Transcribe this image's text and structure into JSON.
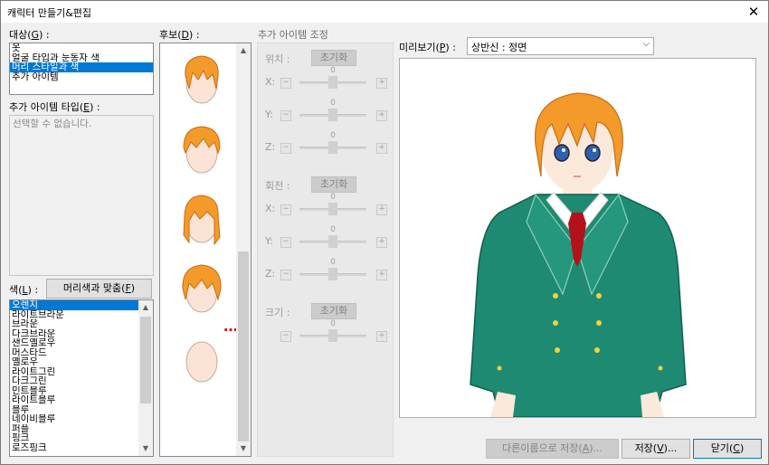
{
  "window": {
    "title": "캐릭터 만들기&편집",
    "close_glyph": "✕"
  },
  "target": {
    "label_prefix": "대상(",
    "label_key": "G",
    "label_suffix": ") :",
    "items": [
      {
        "label": "옷",
        "selected": false
      },
      {
        "label": "얼굴 타입과 눈동자 색",
        "selected": false
      },
      {
        "label": "머리 스타일과 색",
        "selected": true
      },
      {
        "label": "추가 아이템",
        "selected": false
      }
    ]
  },
  "extra_type": {
    "label_prefix": "추가 아이템 타입(",
    "label_key": "E",
    "label_suffix": ") :",
    "placeholder": "선택할 수 없습니다."
  },
  "color": {
    "label_prefix": "색(",
    "label_key": "L",
    "label_suffix": ") :",
    "match_button": {
      "prefix": "머리색과 맞춤(",
      "key": "F",
      "suffix": ")"
    },
    "items": [
      {
        "label": "오렌지",
        "selected": true
      },
      {
        "label": "라이트브라운",
        "selected": false
      },
      {
        "label": "브라운",
        "selected": false
      },
      {
        "label": "다크브라운",
        "selected": false
      },
      {
        "label": "샌드옐로우",
        "selected": false
      },
      {
        "label": "머스타드",
        "selected": false
      },
      {
        "label": "옐로우",
        "selected": false
      },
      {
        "label": "라이트그린",
        "selected": false
      },
      {
        "label": "다크그린",
        "selected": false
      },
      {
        "label": "민트블루",
        "selected": false
      },
      {
        "label": "라이트블루",
        "selected": false
      },
      {
        "label": "블루",
        "selected": false
      },
      {
        "label": "네이비블루",
        "selected": false
      },
      {
        "label": "퍼플",
        "selected": false
      },
      {
        "label": "핑크",
        "selected": false
      },
      {
        "label": "로즈핑크",
        "selected": false
      }
    ]
  },
  "candidates": {
    "label_prefix": "후보(",
    "label_key": "D",
    "label_suffix": ") :",
    "items": [
      {
        "name": "hair-style-1",
        "type": "hair"
      },
      {
        "name": "hair-style-2",
        "type": "hair"
      },
      {
        "name": "hair-style-3",
        "type": "hair"
      },
      {
        "name": "hair-style-4",
        "type": "hair"
      },
      {
        "name": "bald-head",
        "type": "bald"
      }
    ],
    "more_marker": "…?",
    "hair_color": "#f39a2a"
  },
  "adjust": {
    "title": "추가 아이템 조정",
    "reset_label": "초기화",
    "groups": [
      {
        "label": "위치 :",
        "sliders": [
          {
            "axis": "X:",
            "value": "0"
          },
          {
            "axis": "Y:",
            "value": "0"
          },
          {
            "axis": "Z:",
            "value": "0"
          }
        ]
      },
      {
        "label": "회전 :",
        "sliders": [
          {
            "axis": "X:",
            "value": "0"
          },
          {
            "axis": "Y:",
            "value": "0"
          },
          {
            "axis": "Z:",
            "value": "0"
          }
        ]
      },
      {
        "label": "크기 :",
        "sliders": [
          {
            "axis": "",
            "value": "0"
          }
        ]
      }
    ],
    "minus": "−",
    "plus": "+"
  },
  "preview": {
    "label_prefix": "미리보기(",
    "label_key": "P",
    "label_suffix": ") :",
    "mode": "상반신 : 정면",
    "colors": {
      "hair": "#f39a2a",
      "jacket": "#1f8a72",
      "tie": "#b3121c",
      "skin": "#fbe9dc",
      "eyes": "#2f5fb0"
    }
  },
  "buttons": {
    "save_as": {
      "prefix": "다른이름으로 저장(",
      "key": "A",
      "suffix": ")..."
    },
    "save": {
      "prefix": "저장(",
      "key": "V",
      "suffix": ")..."
    },
    "close": {
      "prefix": "닫기(",
      "key": "C",
      "suffix": ")"
    }
  }
}
